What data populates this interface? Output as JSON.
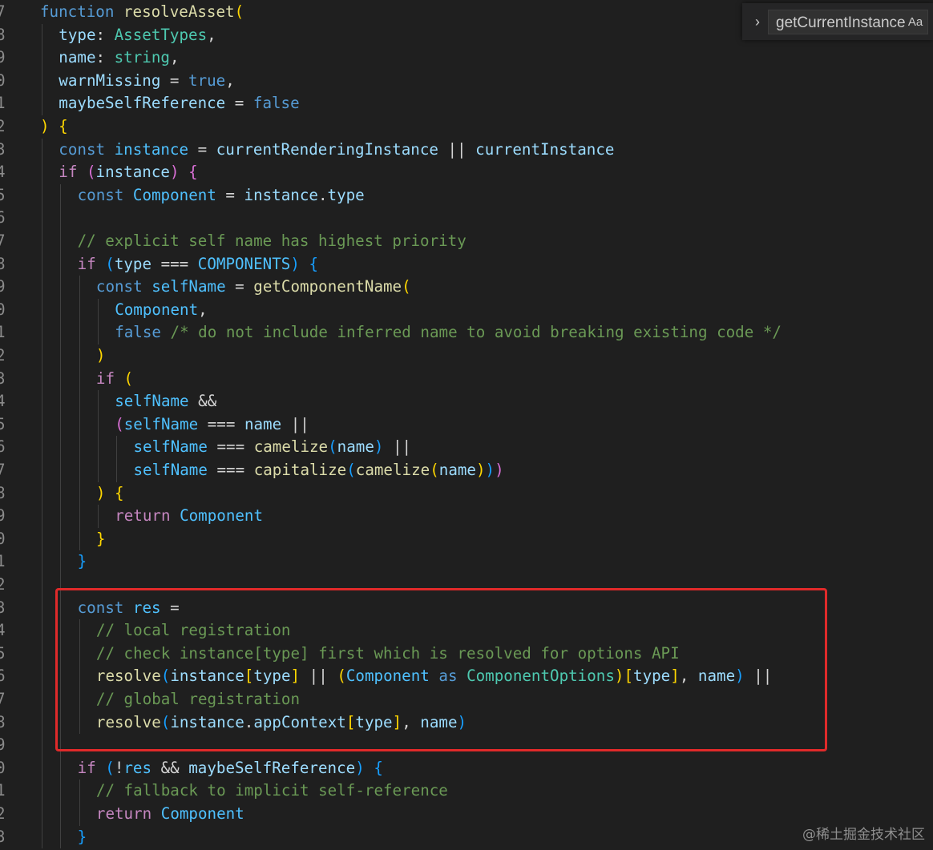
{
  "editor": {
    "lines": [
      {
        "no": "7",
        "indent": 0,
        "tokens": [
          [
            "k",
            "function "
          ],
          [
            "f",
            "resolveAsset"
          ],
          [
            "b1",
            "("
          ]
        ]
      },
      {
        "no": "8",
        "indent": 1,
        "tokens": [
          [
            "v",
            "type"
          ],
          [
            "o",
            ": "
          ],
          [
            "t",
            "AssetTypes"
          ],
          [
            "o",
            ","
          ]
        ]
      },
      {
        "no": "9",
        "indent": 1,
        "tokens": [
          [
            "v",
            "name"
          ],
          [
            "o",
            ": "
          ],
          [
            "t",
            "string"
          ],
          [
            "o",
            ","
          ]
        ]
      },
      {
        "no": "0",
        "indent": 1,
        "tokens": [
          [
            "v",
            "warnMissing"
          ],
          [
            "o",
            " = "
          ],
          [
            "k",
            "true"
          ],
          [
            "o",
            ","
          ]
        ]
      },
      {
        "no": "1",
        "indent": 1,
        "tokens": [
          [
            "v",
            "maybeSelfReference"
          ],
          [
            "o",
            " = "
          ],
          [
            "k",
            "false"
          ]
        ]
      },
      {
        "no": "2",
        "indent": 0,
        "tokens": [
          [
            "b1",
            ")"
          ],
          [
            "o",
            " "
          ],
          [
            "b1",
            "{"
          ]
        ]
      },
      {
        "no": "3",
        "indent": 1,
        "tokens": [
          [
            "k",
            "const "
          ],
          [
            "cst",
            "instance"
          ],
          [
            "o",
            " = "
          ],
          [
            "v",
            "currentRenderingInstance"
          ],
          [
            "o",
            " || "
          ],
          [
            "v",
            "currentInstance"
          ]
        ]
      },
      {
        "no": "4",
        "indent": 1,
        "tokens": [
          [
            "c",
            "if "
          ],
          [
            "b2",
            "("
          ],
          [
            "v",
            "instance"
          ],
          [
            "b2",
            ")"
          ],
          [
            "o",
            " "
          ],
          [
            "b2",
            "{"
          ]
        ]
      },
      {
        "no": "5",
        "indent": 2,
        "tokens": [
          [
            "k",
            "const "
          ],
          [
            "cst",
            "Component"
          ],
          [
            "o",
            " = "
          ],
          [
            "v",
            "instance"
          ],
          [
            "o",
            "."
          ],
          [
            "v",
            "type"
          ]
        ]
      },
      {
        "no": "6",
        "indent": 2,
        "tokens": []
      },
      {
        "no": "7",
        "indent": 2,
        "tokens": [
          [
            "m",
            "// explicit self name has highest priority"
          ]
        ]
      },
      {
        "no": "8",
        "indent": 2,
        "tokens": [
          [
            "c",
            "if "
          ],
          [
            "b3",
            "("
          ],
          [
            "v",
            "type"
          ],
          [
            "o",
            " === "
          ],
          [
            "cst",
            "COMPONENTS"
          ],
          [
            "b3",
            ")"
          ],
          [
            "o",
            " "
          ],
          [
            "b3",
            "{"
          ]
        ]
      },
      {
        "no": "9",
        "indent": 3,
        "tokens": [
          [
            "k",
            "const "
          ],
          [
            "cst",
            "selfName"
          ],
          [
            "o",
            " = "
          ],
          [
            "f",
            "getComponentName"
          ],
          [
            "b1",
            "("
          ]
        ]
      },
      {
        "no": "0",
        "indent": 4,
        "tokens": [
          [
            "cst",
            "Component"
          ],
          [
            "o",
            ","
          ]
        ]
      },
      {
        "no": "1",
        "indent": 4,
        "tokens": [
          [
            "k",
            "false"
          ],
          [
            "o",
            " "
          ],
          [
            "m",
            "/* do not include inferred name to avoid breaking existing code */"
          ]
        ]
      },
      {
        "no": "2",
        "indent": 3,
        "tokens": [
          [
            "b1",
            ")"
          ]
        ]
      },
      {
        "no": "3",
        "indent": 3,
        "tokens": [
          [
            "c",
            "if "
          ],
          [
            "b1",
            "("
          ]
        ]
      },
      {
        "no": "4",
        "indent": 4,
        "tokens": [
          [
            "cst",
            "selfName"
          ],
          [
            "o",
            " &&"
          ]
        ]
      },
      {
        "no": "5",
        "indent": 4,
        "tokens": [
          [
            "b2",
            "("
          ],
          [
            "cst",
            "selfName"
          ],
          [
            "o",
            " === "
          ],
          [
            "v",
            "name"
          ],
          [
            "o",
            " ||"
          ]
        ]
      },
      {
        "no": "6",
        "indent": 5,
        "tokens": [
          [
            "cst",
            "selfName"
          ],
          [
            "o",
            " === "
          ],
          [
            "f",
            "camelize"
          ],
          [
            "b3",
            "("
          ],
          [
            "v",
            "name"
          ],
          [
            "b3",
            ")"
          ],
          [
            "o",
            " ||"
          ]
        ]
      },
      {
        "no": "7",
        "indent": 5,
        "tokens": [
          [
            "cst",
            "selfName"
          ],
          [
            "o",
            " === "
          ],
          [
            "f",
            "capitalize"
          ],
          [
            "b3",
            "("
          ],
          [
            "f",
            "camelize"
          ],
          [
            "b1",
            "("
          ],
          [
            "v",
            "name"
          ],
          [
            "b1",
            ")"
          ],
          [
            "b3",
            ")"
          ],
          [
            "b2",
            ")"
          ]
        ]
      },
      {
        "no": "8",
        "indent": 3,
        "tokens": [
          [
            "b1",
            ")"
          ],
          [
            "o",
            " "
          ],
          [
            "b1",
            "{"
          ]
        ]
      },
      {
        "no": "9",
        "indent": 4,
        "tokens": [
          [
            "c",
            "return "
          ],
          [
            "cst",
            "Component"
          ]
        ]
      },
      {
        "no": "0",
        "indent": 3,
        "tokens": [
          [
            "b1",
            "}"
          ]
        ]
      },
      {
        "no": "1",
        "indent": 2,
        "tokens": [
          [
            "b3",
            "}"
          ]
        ]
      },
      {
        "no": "2",
        "indent": 2,
        "tokens": []
      },
      {
        "no": "3",
        "indent": 2,
        "tokens": [
          [
            "k",
            "const "
          ],
          [
            "cst",
            "res"
          ],
          [
            "o",
            " ="
          ]
        ]
      },
      {
        "no": "4",
        "indent": 3,
        "tokens": [
          [
            "m",
            "// local registration"
          ]
        ]
      },
      {
        "no": "5",
        "indent": 3,
        "tokens": [
          [
            "m",
            "// check instance[type] first which is resolved for options API"
          ]
        ]
      },
      {
        "no": "6",
        "indent": 3,
        "tokens": [
          [
            "f",
            "resolve"
          ],
          [
            "b3",
            "("
          ],
          [
            "v",
            "instance"
          ],
          [
            "b1",
            "["
          ],
          [
            "v",
            "type"
          ],
          [
            "b1",
            "]"
          ],
          [
            "o",
            " || "
          ],
          [
            "b1",
            "("
          ],
          [
            "cst",
            "Component"
          ],
          [
            "k",
            " as "
          ],
          [
            "t",
            "ComponentOptions"
          ],
          [
            "b1",
            ")"
          ],
          [
            "b1",
            "["
          ],
          [
            "v",
            "type"
          ],
          [
            "b1",
            "]"
          ],
          [
            "o",
            ", "
          ],
          [
            "v",
            "name"
          ],
          [
            "b3",
            ")"
          ],
          [
            "o",
            " ||"
          ]
        ]
      },
      {
        "no": "7",
        "indent": 3,
        "tokens": [
          [
            "m",
            "// global registration"
          ]
        ]
      },
      {
        "no": "8",
        "indent": 3,
        "tokens": [
          [
            "f",
            "resolve"
          ],
          [
            "b3",
            "("
          ],
          [
            "v",
            "instance"
          ],
          [
            "o",
            "."
          ],
          [
            "v",
            "appContext"
          ],
          [
            "b1",
            "["
          ],
          [
            "v",
            "type"
          ],
          [
            "b1",
            "]"
          ],
          [
            "o",
            ", "
          ],
          [
            "v",
            "name"
          ],
          [
            "b3",
            ")"
          ]
        ]
      },
      {
        "no": "9",
        "indent": 2,
        "tokens": []
      },
      {
        "no": "0",
        "indent": 2,
        "tokens": [
          [
            "c",
            "if "
          ],
          [
            "b3",
            "("
          ],
          [
            "o",
            "!"
          ],
          [
            "cst",
            "res"
          ],
          [
            "o",
            " && "
          ],
          [
            "v",
            "maybeSelfReference"
          ],
          [
            "b3",
            ")"
          ],
          [
            "o",
            " "
          ],
          [
            "b3",
            "{"
          ]
        ]
      },
      {
        "no": "1",
        "indent": 3,
        "tokens": [
          [
            "m",
            "// fallback to implicit self-reference"
          ]
        ]
      },
      {
        "no": "2",
        "indent": 3,
        "tokens": [
          [
            "c",
            "return "
          ],
          [
            "cst",
            "Component"
          ]
        ]
      },
      {
        "no": "3",
        "indent": 2,
        "tokens": [
          [
            "b3",
            "}"
          ]
        ]
      }
    ]
  },
  "find_widget": {
    "toggle_icon": "chevron-right-icon",
    "toggle_glyph": "›",
    "query": "getCurrentInstance",
    "match_case_label": "Aa"
  },
  "watermark": "@稀土掘金技术社区",
  "colors": {
    "background": "#1f1f1f",
    "highlight_border": "#e02a2a",
    "keyword": "#569cd6",
    "control": "#c586c0",
    "variable": "#9cdcfe",
    "constant": "#4fc1ff",
    "type": "#4ec9b0",
    "function": "#dcdcaa",
    "comment": "#6a9955"
  }
}
